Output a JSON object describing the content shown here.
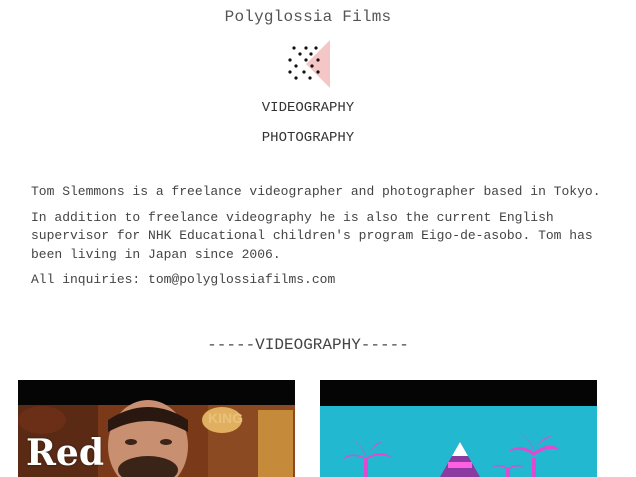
{
  "site": {
    "title": "Polyglossia Films"
  },
  "logo": {
    "icon": "dot-triangle-logo-icon",
    "accent_color": "#f5c6c6"
  },
  "nav": {
    "videography": "VIDEOGRAPHY",
    "photography": "PHOTOGRAPHY"
  },
  "bio": {
    "paragraph_1": "Tom Slemmons is a freelance videographer and photographer based in Tokyo.",
    "paragraph_2": "In addition to freelance videography he is also the current English supervisor for NHK Educational children's program Eigo-de-asobo. Tom has been living in Japan since 2006.",
    "inquiries": "All inquiries: tom@polyglossiafilms.com"
  },
  "section": {
    "videography_heading": "-----VIDEOGRAPHY-----"
  },
  "videos": [
    {
      "overlay_text": "Red",
      "sign_text": "KING"
    },
    {
      "overlay_text": ""
    }
  ]
}
